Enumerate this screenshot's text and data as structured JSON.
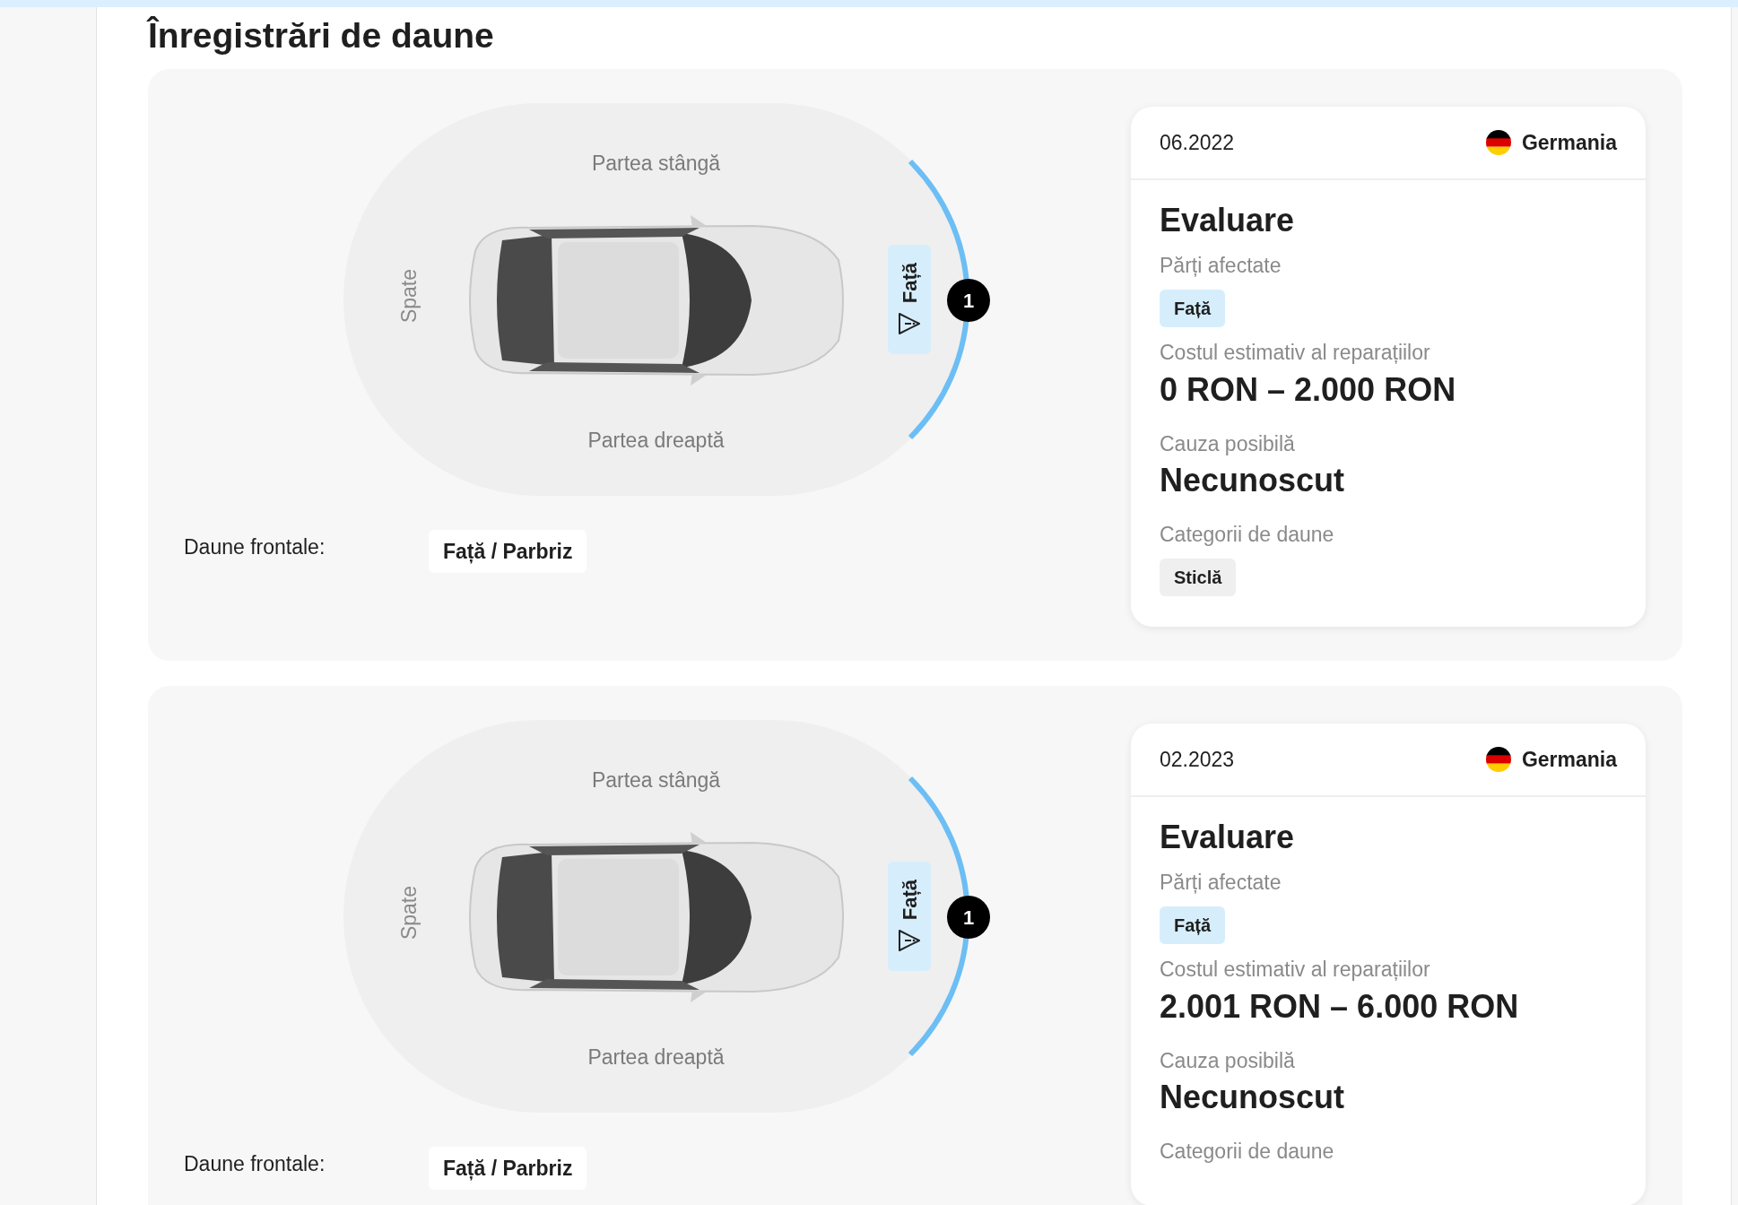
{
  "title": "Înregistrări de daune",
  "records": [
    {
      "diagram": {
        "top_label": "Partea stângă",
        "bottom_label": "Partea dreaptă",
        "left_label": "Spate",
        "front_zone": {
          "label": "Față",
          "marker": "1"
        }
      },
      "damage_rows": [
        {
          "label": "Daune frontale:",
          "value": "Față / Parbriz"
        }
      ],
      "card": {
        "date": "06.2022",
        "country": "Germania",
        "title": "Evaluare",
        "sections": [
          {
            "kind": "parts",
            "label": "Părți afectate",
            "tags": [
              "Față"
            ]
          },
          {
            "kind": "value",
            "label": "Costul estimativ al reparațiilor",
            "value": "0 RON – 2.000 RON"
          },
          {
            "kind": "value",
            "label": "Cauza posibilă",
            "value": "Necunoscut"
          },
          {
            "kind": "categories",
            "label": "Categorii de daune",
            "tags": [
              "Sticlă"
            ]
          }
        ]
      }
    },
    {
      "diagram": {
        "top_label": "Partea stângă",
        "bottom_label": "Partea dreaptă",
        "left_label": "Spate",
        "front_zone": {
          "label": "Față",
          "marker": "1"
        }
      },
      "damage_rows": [
        {
          "label": "Daune frontale:",
          "value": "Față / Parbriz"
        }
      ],
      "card": {
        "date": "02.2023",
        "country": "Germania",
        "title": "Evaluare",
        "sections": [
          {
            "kind": "parts",
            "label": "Părți afectate",
            "tags": [
              "Față"
            ]
          },
          {
            "kind": "value",
            "label": "Costul estimativ al reparațiilor",
            "value": "2.001 RON – 6.000 RON"
          },
          {
            "kind": "value",
            "label": "Cauza posibilă",
            "value": "Necunoscut"
          },
          {
            "kind": "categories",
            "label": "Categorii de daune"
          }
        ]
      }
    }
  ]
}
